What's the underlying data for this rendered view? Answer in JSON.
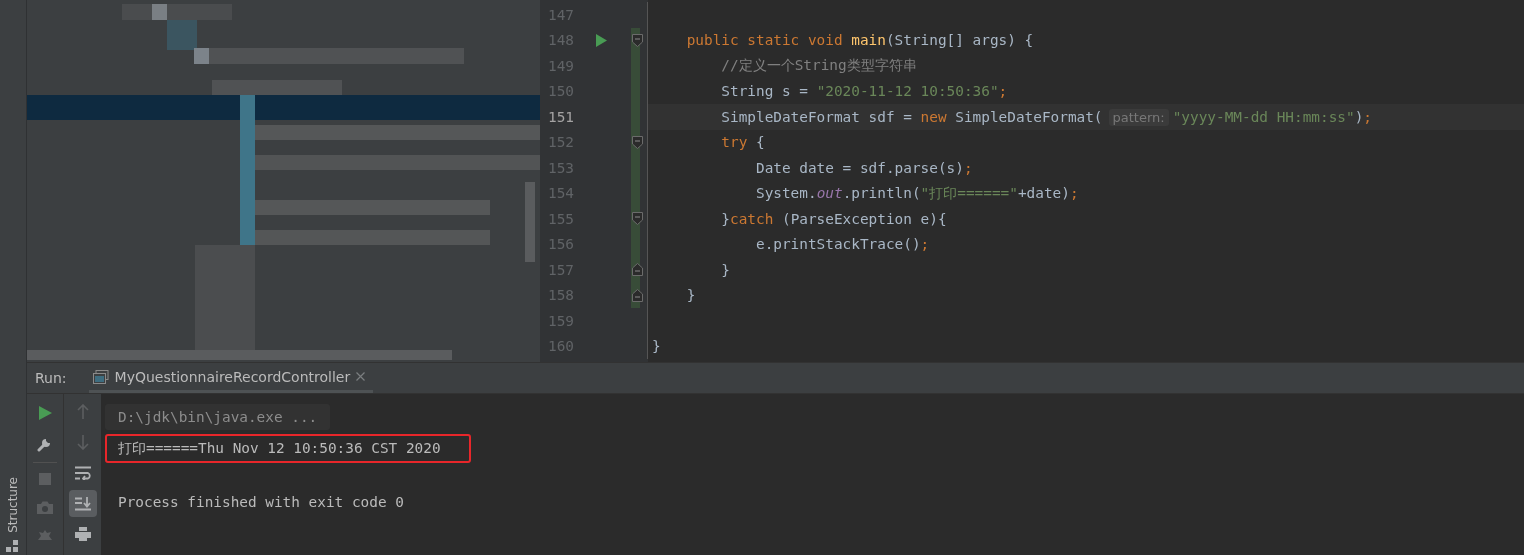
{
  "sidebar": {
    "label": "Structure"
  },
  "editor": {
    "lines": [
      {
        "number": "147"
      },
      {
        "number": "148",
        "run": true,
        "fold_open": true,
        "changed": true,
        "tokens": [
          {
            "text": "    public static void ",
            "kind": "keyword"
          },
          {
            "text": "main",
            "kind": "method"
          },
          {
            "text": "(String[] args) {",
            "kind": "plain"
          }
        ]
      },
      {
        "number": "149",
        "changed": true,
        "tokens": [
          {
            "text": "        //定义一个String类型字符串",
            "kind": "comment"
          }
        ]
      },
      {
        "number": "150",
        "changed": true,
        "tokens": [
          {
            "text": "        String s = ",
            "kind": "plain"
          },
          {
            "text": "\"2020-11-12 10:50:36\"",
            "kind": "string"
          },
          {
            "text": ";",
            "kind": "keyword"
          }
        ]
      },
      {
        "number": "151",
        "current": true,
        "changed": true,
        "tokens": [
          {
            "text": "        SimpleDateFormat sdf = ",
            "kind": "plain"
          },
          {
            "text": "new ",
            "kind": "keyword"
          },
          {
            "text": "SimpleDateFormat(",
            "kind": "plain"
          },
          {
            "text": "pattern:",
            "kind": "hint"
          },
          {
            "text": "\"yyyy-MM-dd HH:mm:ss\"",
            "kind": "string"
          },
          {
            "text": ")",
            "kind": "plain"
          },
          {
            "text": ";",
            "kind": "keyword"
          }
        ]
      },
      {
        "number": "152",
        "fold_open": true,
        "changed": true,
        "tokens": [
          {
            "text": "        try ",
            "kind": "keyword"
          },
          {
            "text": "{",
            "kind": "plain"
          }
        ]
      },
      {
        "number": "153",
        "changed": true,
        "tokens": [
          {
            "text": "            Date date = sdf.parse(s)",
            "kind": "plain"
          },
          {
            "text": ";",
            "kind": "keyword"
          }
        ]
      },
      {
        "number": "154",
        "changed": true,
        "tokens": [
          {
            "text": "            System.",
            "kind": "plain"
          },
          {
            "text": "out",
            "kind": "field"
          },
          {
            "text": ".println(",
            "kind": "plain"
          },
          {
            "text": "\"打印======\"",
            "kind": "string"
          },
          {
            "text": "+date)",
            "kind": "plain"
          },
          {
            "text": ";",
            "kind": "keyword"
          }
        ]
      },
      {
        "number": "155",
        "fold_open": true,
        "changed": true,
        "tokens": [
          {
            "text": "        }",
            "kind": "plain"
          },
          {
            "text": "catch ",
            "kind": "keyword"
          },
          {
            "text": "(ParseException e){",
            "kind": "plain"
          }
        ]
      },
      {
        "number": "156",
        "changed": true,
        "tokens": [
          {
            "text": "            e.printStackTrace()",
            "kind": "plain"
          },
          {
            "text": ";",
            "kind": "keyword"
          }
        ]
      },
      {
        "number": "157",
        "fold_close": true,
        "changed": true,
        "tokens": [
          {
            "text": "        }",
            "kind": "plain"
          }
        ]
      },
      {
        "number": "158",
        "fold_close": true,
        "changed": true,
        "tokens": [
          {
            "text": "    }",
            "kind": "plain"
          }
        ]
      },
      {
        "number": "159"
      },
      {
        "number": "160",
        "tokens": [
          {
            "text": "}",
            "kind": "plain"
          }
        ]
      }
    ]
  },
  "run_panel": {
    "label": "Run:",
    "tabs": [
      {
        "label": "MyQuestionnaireRecordController",
        "selected": true
      }
    ],
    "scroll_to_end": true,
    "output": [
      {
        "kind": "command",
        "text": "D:\\jdk\\bin\\java.exe ...",
        "highlighted": false
      },
      {
        "kind": "stdout",
        "text": "打印======Thu Nov 12 10:50:36 CST 2020",
        "highlighted": true
      },
      {
        "kind": "exit",
        "text": "Process finished with exit code 0",
        "highlighted": false
      }
    ]
  }
}
